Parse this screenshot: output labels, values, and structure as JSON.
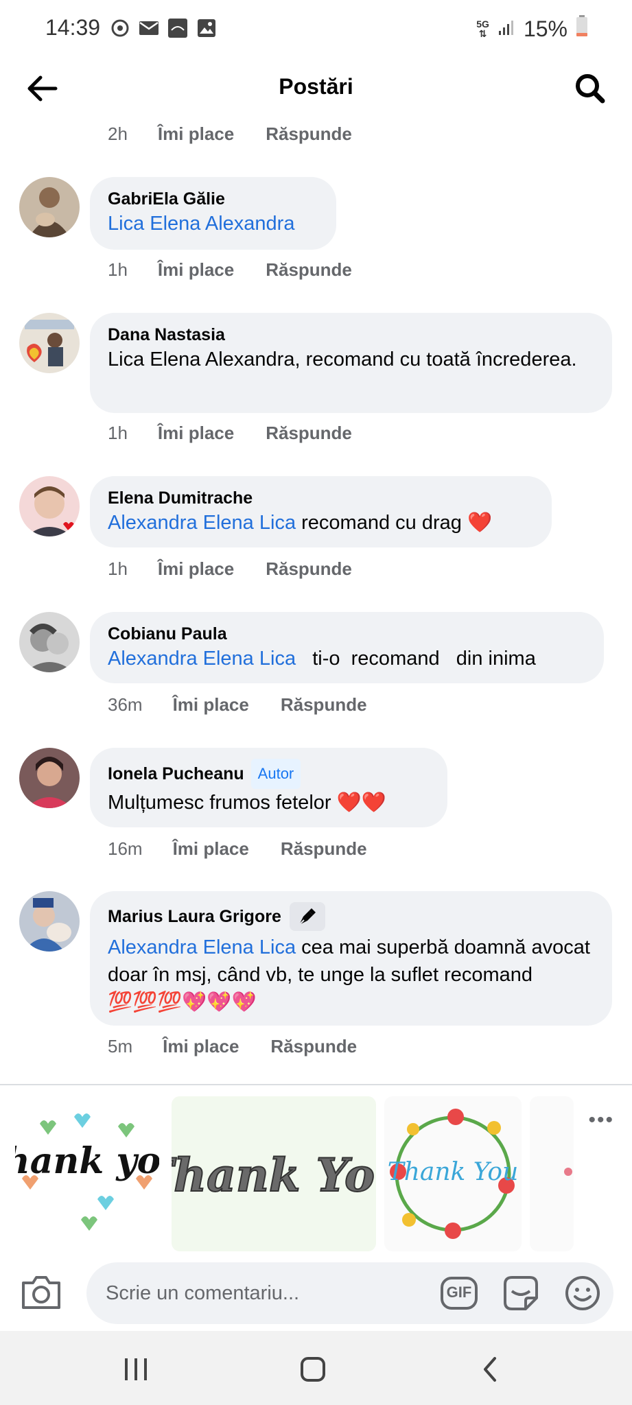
{
  "status": {
    "time": "14:39",
    "network": "5G",
    "battery": "15%"
  },
  "header": {
    "title": "Postări"
  },
  "labels": {
    "like": "Îmi place",
    "reply": "Răspunde"
  },
  "prev_actions": {
    "time": "2h"
  },
  "comments": [
    {
      "author": "GabriEla Gălie",
      "mention": "Lica Elena Alexandra",
      "text": "",
      "time": "1h"
    },
    {
      "author": "Dana Nastasia",
      "mention": "",
      "text": "Lica Elena Alexandra, recomand cu toată încrederea.",
      "time": "1h"
    },
    {
      "author": "Elena Dumitrache",
      "mention": "Alexandra Elena Lica",
      "text": " recomand cu drag ",
      "emoji": "❤️",
      "time": "1h"
    },
    {
      "author": "Cobianu Paula",
      "mention": "Alexandra Elena Lica",
      "text": "   ti-o  recomand   din inima",
      "time": "36m"
    },
    {
      "author": "Ionela Pucheanu",
      "badge": "Autor",
      "mention": "",
      "text": "Mulțumesc frumos fetelor ",
      "emoji": "❤️❤️",
      "time": "16m"
    },
    {
      "author": "Marius Laura Grigore",
      "mention": "Alexandra Elena Lica",
      "text": " cea mai superbă doamnă avocat doar în msj, când vb, te unge la suflet recomand ",
      "emoji": "💯💯💯💖💖💖",
      "time": "5m"
    }
  ],
  "stickers": [
    {
      "name": "thank-you-hearts-sticker",
      "text": "thank you"
    },
    {
      "name": "thank-you-marble-sticker",
      "text": "Thank You"
    },
    {
      "name": "thank-you-flowers-sticker",
      "text": "Thank You"
    }
  ],
  "composer": {
    "placeholder": "Scrie un comentariu...",
    "gif": "GIF"
  },
  "colors": {
    "mention": "#216fdb",
    "bubble": "#f0f2f5",
    "muted": "#65676b"
  }
}
